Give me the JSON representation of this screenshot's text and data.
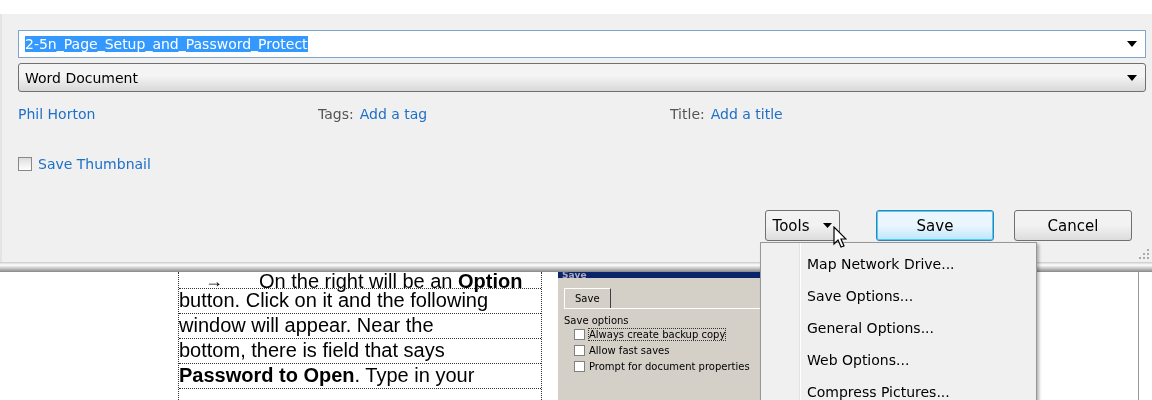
{
  "file_name": {
    "value": "2-5n_Page_Setup_and_Password_Protect",
    "selected": true
  },
  "save_as_type": {
    "value": "Word Document"
  },
  "authors": "Phil Horton",
  "tags": {
    "label": "Tags:",
    "link": "Add a tag"
  },
  "title": {
    "label": "Title:",
    "link": "Add a title"
  },
  "save_thumbnail": {
    "label": "Save Thumbnail",
    "checked": false
  },
  "buttons": [
    {
      "label": "Tools",
      "kind": "dropdown"
    },
    {
      "label": "Save",
      "kind": "default"
    },
    {
      "label": "Cancel",
      "kind": "plain"
    }
  ],
  "tools_menu": {
    "open": true,
    "items": [
      {
        "label": "Map Network Drive..."
      },
      {
        "label": "Save Options..."
      },
      {
        "label": "General Options..."
      },
      {
        "label": "Web Options..."
      },
      {
        "label": "Compress Pictures..."
      }
    ]
  },
  "document": {
    "lines": [
      {
        "bullet": "→",
        "text": "On the right will be an **Option**"
      },
      {
        "text": "button. Click on it and the following"
      },
      {
        "text": "window will appear. Near the"
      },
      {
        "text": "bottom, there is field that says"
      },
      {
        "text": "**Password to Open**. Type in your"
      }
    ]
  },
  "embedded_dialog": {
    "title": "Save",
    "tab": "Save",
    "group": "Save options",
    "options": [
      {
        "label": "Always create backup copy",
        "checked": false,
        "focused": true
      },
      {
        "label": "Allow fast saves",
        "checked": false,
        "focused": false
      },
      {
        "label": "Prompt for document properties",
        "checked": false,
        "focused": false
      }
    ]
  }
}
